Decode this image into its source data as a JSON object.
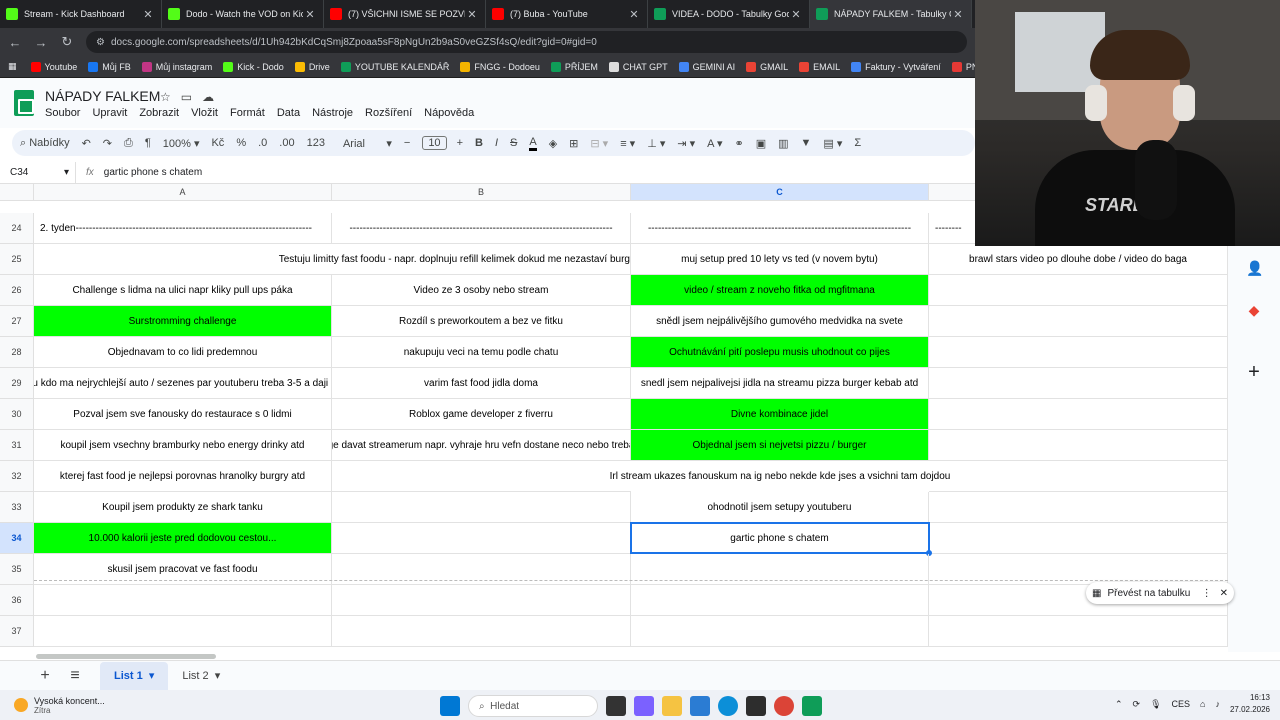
{
  "browser": {
    "tabs": [
      {
        "title": "Stream - Kick Dashboard",
        "color": "#53fc18",
        "active": false
      },
      {
        "title": "Dodo - Watch the VOD on Kick",
        "color": "#53fc18",
        "active": false
      },
      {
        "title": "(7) VŠICHNI ISME SE POZVRAC",
        "color": "#ff0000",
        "active": false
      },
      {
        "title": "(7) Buba - YouTube",
        "color": "#ff0000",
        "active": false
      },
      {
        "title": "VIDEA - DODO - Tabulky Googl",
        "color": "#0f9d58",
        "active": false
      },
      {
        "title": "NÁPADY FALKEM - Tabulky Goo",
        "color": "#0f9d58",
        "active": true
      }
    ],
    "url": "docs.google.com/spreadsheets/d/1Uh942bKdCqSmj8Zpoaa5sF8pNgUn2b9aS0veGZSf4sQ/edit?gid=0#gid=0",
    "bookmarks": [
      {
        "label": "Youtube",
        "color": "#ff0000"
      },
      {
        "label": "Můj FB",
        "color": "#1877f2"
      },
      {
        "label": "Můj instagram",
        "color": "#c13584"
      },
      {
        "label": "Kick - Dodo",
        "color": "#53fc18"
      },
      {
        "label": "Drive",
        "color": "#fbbc04"
      },
      {
        "label": "YOUTUBE KALENDÁŘ",
        "color": "#0f9d58"
      },
      {
        "label": "FNGG - Dodoeu",
        "color": "#f4b400"
      },
      {
        "label": "PŘÍJEM",
        "color": "#0f9d58"
      },
      {
        "label": "CHAT GPT",
        "color": "#dddddd"
      },
      {
        "label": "GEMINI AI",
        "color": "#4285f4"
      },
      {
        "label": "GMAIL",
        "color": "#ea4335"
      },
      {
        "label": "EMAIL",
        "color": "#ea4335"
      },
      {
        "label": "Faktury - Vytváření",
        "color": "#4285f4"
      },
      {
        "label": "PNG to PDF",
        "color": "#e53935"
      }
    ]
  },
  "doc": {
    "title": "NÁPADY FALKEM",
    "menu": [
      "Soubor",
      "Upravit",
      "Zobrazit",
      "Vložit",
      "Formát",
      "Data",
      "Nástroje",
      "Rozšíření",
      "Nápověda"
    ],
    "toolbar": {
      "search": "Nabídky",
      "zoom": "100%",
      "currency": "Kč",
      "percent": "%",
      "dec_less": ".0",
      "dec_more": ".00",
      "num": "123",
      "font": "Arial",
      "font_size": "10"
    },
    "namebox": "C34",
    "formula": "gartic phone s chatem"
  },
  "grid": {
    "columns": [
      "A",
      "B",
      "C"
    ],
    "rows": [
      {
        "num": "24",
        "a": "2. tyden-----------------------------------------------------------------------",
        "b": "-------------------------------------------------------------------------------",
        "c": "-------------------------------------------------------------------------------",
        "d": "--------"
      },
      {
        "num": "25",
        "a": "",
        "b": "Testuju limitty fast foodu - napr. doplnuju refill kelimek dokud me nezastaví burg",
        "c": "muj setup pred 10 lety vs ted (v novem bytu)",
        "d": "brawl stars video po dlouhe dobe / video do baga"
      },
      {
        "num": "26",
        "a": "Challenge s lidma na ulici napr kliky pull ups páka",
        "b": "Video ze 3 osoby nebo stream",
        "c": "video / stream z noveho fitka od mgfitmana",
        "d": ""
      },
      {
        "num": "27",
        "a": "Surstromming challenge",
        "b": "Rozdíl s preworkoutem a bez ve fitku",
        "c": "snědl jsem nejpálivějšího gumového medvidka na svete",
        "d": ""
      },
      {
        "num": "28",
        "a": "Objednavam to co lidi predemnou",
        "b": "nakupuju veci na temu podle chatu",
        "c": "Ochutnávání pití poslepu musis uhodnout co pijes",
        "d": ""
      },
      {
        "num": "29",
        "a": "ru kdo ma nejrychlejší auto / sezenes par youtuberu treba 3-5 a daji s",
        "b": "varim fast food jidla doma",
        "c": "snedl jsem nejpalivejsi jidla na streamu pizza burger  kebab atd",
        "d": ""
      },
      {
        "num": "30",
        "a": "Pozval jsem sve fanousky do restaurace s 0 lidmi",
        "b": "Roblox game developer z fiverru",
        "c": "Divne kombinace jidel",
        "d": ""
      },
      {
        "num": "31",
        "a": "koupil jsem vsechny bramburky nebo energy drinky atd",
        "b": "ge davat streamerum napr. vyhraje hru vefn dostane neco nebo treba",
        "c": "Objednal jsem si nejvetsi pizzu / burger",
        "d": ""
      },
      {
        "num": "32",
        "a": "kterej fast food je nejlepsi porovnas hranolky burgry atd",
        "b": "",
        "c": "Irl stream ukazes fanouskum na ig nebo nekde kde jses a vsichni tam dojdou",
        "d": ""
      },
      {
        "num": "33",
        "a": "Koupil jsem produkty ze shark tanku",
        "b": "",
        "c": "ohodnotil jsem setupy youtuberu",
        "d": ""
      },
      {
        "num": "34",
        "a": "10.000 kalorii jeste pred dodovou cestou...",
        "b": "",
        "c": "gartic phone s chatem",
        "d": ""
      },
      {
        "num": "35",
        "a": "skusil jsem pracovat ve fast foodu",
        "b": "",
        "c": "",
        "d": ""
      },
      {
        "num": "36",
        "a": "",
        "b": "",
        "c": "",
        "d": ""
      },
      {
        "num": "37",
        "a": "",
        "b": "",
        "c": "",
        "d": ""
      }
    ]
  },
  "convert_chip": "Převést na tabulku",
  "sheets": [
    "List 1",
    "List 2"
  ],
  "taskbar": {
    "weather_title": "Vysoká koncent...",
    "weather_sub": "Zítra",
    "search": "Hledat",
    "lang": "CES",
    "time": "16:13",
    "date": "27.02.2026"
  },
  "webcam": {
    "shirt_text": "STARDZE"
  },
  "colors": {
    "green": "#00ff00",
    "selection": "#1a73e8",
    "sheets_green": "#0f9d58"
  }
}
